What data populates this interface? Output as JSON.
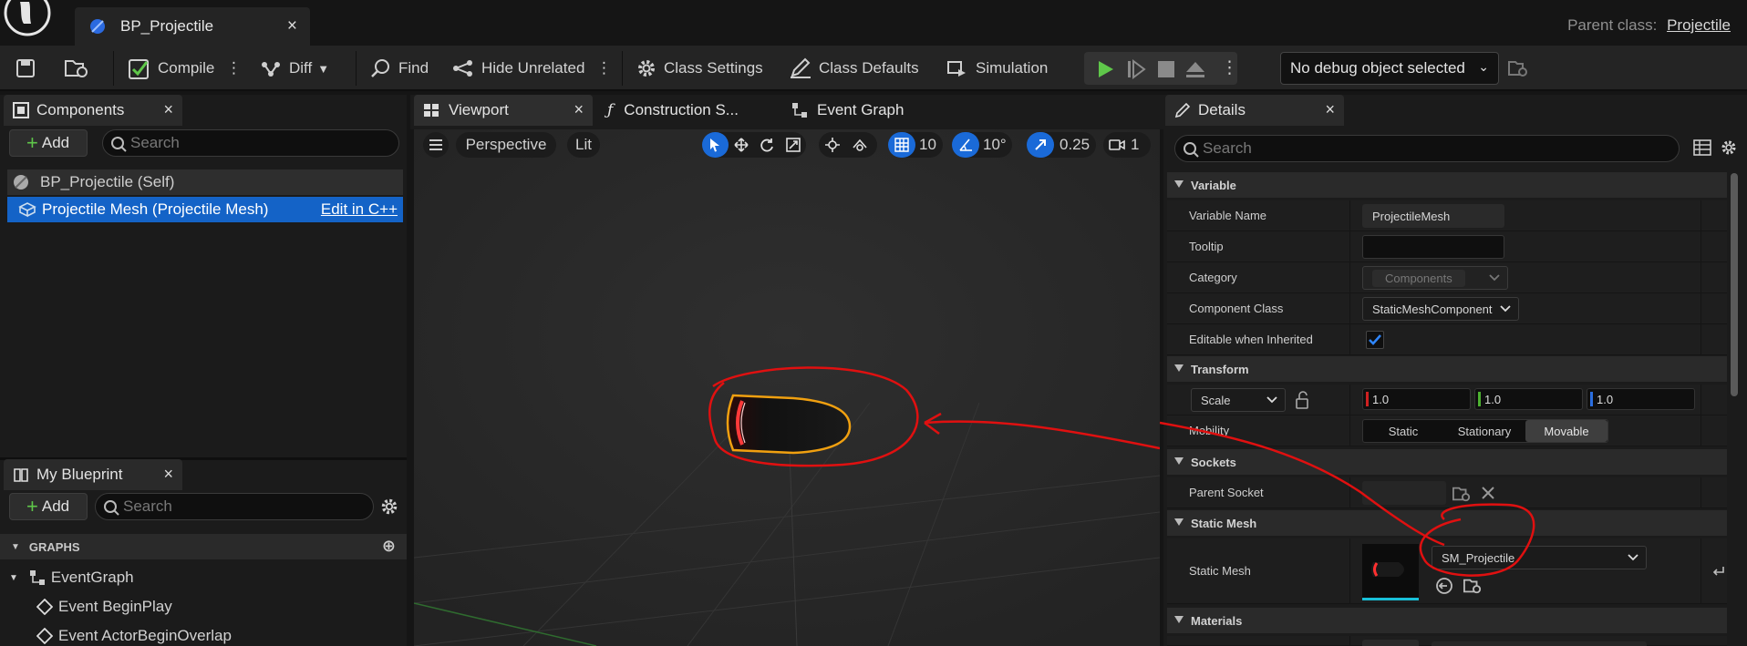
{
  "window": {
    "tab_title": "BP_Projectile",
    "parent_class_label": "Parent class:",
    "parent_class_value": "Projectile"
  },
  "toolbar": {
    "compile": "Compile",
    "diff": "Diff",
    "find": "Find",
    "hide_unrelated": "Hide Unrelated",
    "class_settings": "Class Settings",
    "class_defaults": "Class Defaults",
    "simulation": "Simulation",
    "debug_object": "No debug object selected"
  },
  "components_panel": {
    "title": "Components",
    "add": "Add",
    "search_placeholder": "Search",
    "self_item": "BP_Projectile (Self)",
    "mesh_item": "Projectile Mesh (Projectile Mesh)",
    "edit_cpp": "Edit in C++"
  },
  "my_blueprint": {
    "title": "My Blueprint",
    "add": "Add",
    "search_placeholder": "Search",
    "graphs_header": "GRAPHS",
    "items": [
      "EventGraph",
      "Event BeginPlay",
      "Event ActorBeginOverlap"
    ]
  },
  "editor_tabs": [
    "Viewport",
    "Construction S...",
    "Event Graph"
  ],
  "viewport": {
    "perspective": "Perspective",
    "lit": "Lit",
    "grid_snap": "10",
    "rotation_snap": "10°",
    "scale_snap": "0.25",
    "camera_speed": "1"
  },
  "details": {
    "title": "Details",
    "search_placeholder": "Search",
    "categories": {
      "variable": "Variable",
      "transform": "Transform",
      "sockets": "Sockets",
      "static_mesh": "Static Mesh",
      "materials": "Materials"
    },
    "variable_name_label": "Variable Name",
    "variable_name_value": "ProjectileMesh",
    "tooltip_label": "Tooltip",
    "tooltip_value": "",
    "category_label": "Category",
    "category_value": "Components",
    "component_class_label": "Component Class",
    "component_class_value": "StaticMeshComponent",
    "editable_label": "Editable when Inherited",
    "editable_checked": true,
    "scale_label": "Scale",
    "scale_x": "1.0",
    "scale_y": "1.0",
    "scale_z": "1.0",
    "mobility_label": "Mobility",
    "mobility_options": [
      "Static",
      "Stationary",
      "Movable"
    ],
    "mobility_selected": "Movable",
    "parent_socket_label": "Parent Socket",
    "static_mesh_label": "Static Mesh",
    "static_mesh_value": "SM_Projectile"
  },
  "colors": {
    "accent_blue": "#1463c7",
    "play_green": "#5fc74a",
    "annotation_red": "#e01010",
    "selection_orange": "#f0a010"
  }
}
